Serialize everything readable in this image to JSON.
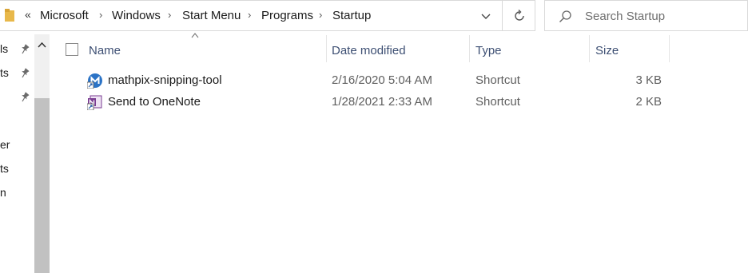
{
  "address_bar": {
    "overflow_glyph": "«",
    "crumbs": [
      "Microsoft",
      "Windows",
      "Start Menu",
      "Programs",
      "Startup"
    ],
    "separator": "›"
  },
  "search": {
    "placeholder": "Search Startup"
  },
  "nav_pane": {
    "fragments": [
      "ls",
      "ts",
      "er",
      "ts",
      "n"
    ]
  },
  "columns": {
    "name": "Name",
    "date_modified": "Date modified",
    "type": "Type",
    "size": "Size"
  },
  "files": [
    {
      "name": "mathpix-snipping-tool",
      "date_modified": "2/16/2020 5:04 AM",
      "type": "Shortcut",
      "size": "3 KB",
      "icon": "mathpix-icon"
    },
    {
      "name": "Send to OneNote",
      "date_modified": "1/28/2021 2:33 AM",
      "type": "Shortcut",
      "size": "2 KB",
      "icon": "onenote-icon"
    }
  ],
  "colors": {
    "header_text": "#3d4f73",
    "accent_blue": "#2b73c6",
    "folder": "#e8b84a"
  }
}
